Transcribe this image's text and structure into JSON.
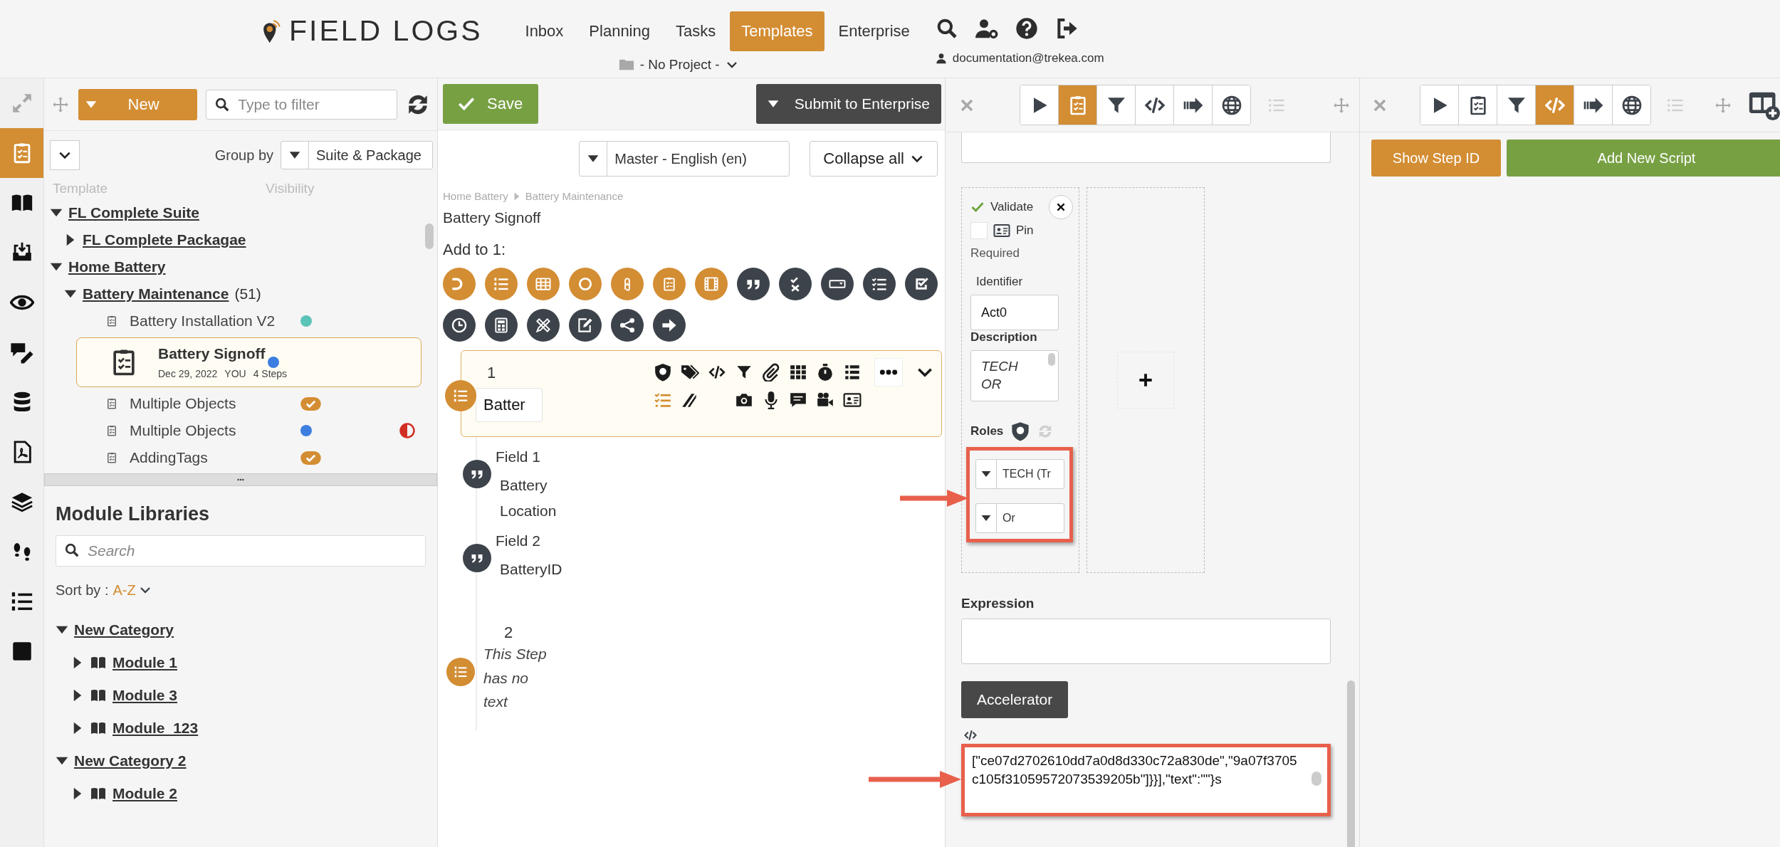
{
  "header": {
    "logo": "FIELD LOGS",
    "nav": [
      {
        "label": "Inbox",
        "selected": false
      },
      {
        "label": "Planning",
        "selected": false
      },
      {
        "label": "Tasks",
        "selected": false
      },
      {
        "label": "Templates",
        "selected": true
      },
      {
        "label": "Enterprise",
        "selected": false
      }
    ],
    "project": "- No Project -",
    "user_email": "documentation@trekea.com"
  },
  "rail": [
    {
      "kind": "expand",
      "selected": false
    },
    {
      "kind": "clipboard",
      "selected": true
    },
    {
      "kind": "book",
      "selected": false
    },
    {
      "kind": "inbox",
      "selected": false
    },
    {
      "kind": "eye",
      "selected": false
    },
    {
      "kind": "chat-pencil",
      "selected": false
    },
    {
      "kind": "database",
      "selected": false
    },
    {
      "kind": "pdf",
      "selected": false
    },
    {
      "kind": "layers",
      "selected": false
    },
    {
      "kind": "footprints",
      "selected": false
    },
    {
      "kind": "numbered-list",
      "selected": false
    },
    {
      "kind": "square",
      "selected": false
    }
  ],
  "templates": {
    "new_button": "New",
    "filter_placeholder": "Type to filter",
    "group_by_label": "Group by",
    "group_by_value": "Suite & Package",
    "columns": [
      "Template",
      "Visibility"
    ],
    "tree": [
      {
        "name": "FL Complete Suite",
        "expanded": true,
        "children": [
          {
            "name": "FL Complete Packagae",
            "expanded": false
          }
        ]
      },
      {
        "name": "Home Battery",
        "expanded": true,
        "children": [
          {
            "name": "Battery Maintenance",
            "count": "(51)",
            "expanded": true,
            "children": [
              {
                "name": "Battery Installation V2",
                "selected": false,
                "visibility": {
                  "kind": "dot",
                  "color": "#5bc4b8"
                },
                "partial": false
              },
              {
                "name": "Battery Signoff",
                "selected": true,
                "meta": [
                  "Dec 29, 2022",
                  "YOU",
                  "4 Steps"
                ],
                "visibility": {
                  "kind": "dot",
                  "color": "#3d7fe0"
                },
                "partial": false
              },
              {
                "name": "Multiple Objects",
                "selected": false,
                "visibility": {
                  "kind": "check",
                  "color": "#d38d33"
                },
                "partial": false
              },
              {
                "name": "Multiple Objects",
                "selected": false,
                "visibility": {
                  "kind": "dot",
                  "color": "#3d7fe0"
                },
                "partial": true
              },
              {
                "name": "AddingTags",
                "selected": false,
                "visibility": {
                  "kind": "check",
                  "color": "#d38d33"
                },
                "partial": false
              }
            ]
          }
        ]
      }
    ]
  },
  "modules": {
    "title": "Module Libraries",
    "search_placeholder": "Search",
    "sort_label": "Sort by :",
    "sort_value": "A-Z",
    "categories": [
      {
        "name": "New Category",
        "expanded": true,
        "children": [
          {
            "name": "Module 1",
            "expanded": false
          },
          {
            "name": "Module 3",
            "expanded": false
          },
          {
            "name": "Module_123",
            "expanded": false
          }
        ]
      },
      {
        "name": "New Category 2",
        "expanded": true,
        "children": [
          {
            "name": "Module 2",
            "expanded": false
          }
        ]
      }
    ]
  },
  "editor": {
    "save": "Save",
    "submit": "Submit to Enterprise",
    "language": "Master - English (en)",
    "collapse": "Collapse all",
    "breadcrumb": [
      "Home Battery",
      "Battery Maintenance"
    ],
    "title": "Battery Signoff",
    "add_to": "Add to 1:",
    "palette": [
      {
        "kind": "arc",
        "color": "#d38d33"
      },
      {
        "kind": "numbered-list",
        "color": "#d38d33"
      },
      {
        "kind": "table",
        "color": "#d38d33"
      },
      {
        "kind": "ring",
        "color": "#d38d33"
      },
      {
        "kind": "attachment",
        "color": "#d38d33"
      },
      {
        "kind": "clipboard",
        "color": "#d38d33"
      },
      {
        "kind": "film",
        "color": "#d38d33"
      },
      {
        "kind": "quote",
        "color": "#3d434a"
      },
      {
        "kind": "check-x",
        "color": "#3d434a"
      },
      {
        "kind": "dropdown",
        "color": "#3d434a"
      },
      {
        "kind": "checklist",
        "color": "#3d434a"
      },
      {
        "kind": "checkbox",
        "color": "#3d434a"
      },
      {
        "kind": "clock",
        "color": "#3d434a"
      },
      {
        "kind": "calculator",
        "color": "#3d434a"
      },
      {
        "kind": "pencil-ruler",
        "color": "#3d434a"
      },
      {
        "kind": "edit",
        "color": "#3d434a"
      },
      {
        "kind": "share",
        "color": "#3d434a"
      },
      {
        "kind": "arrow-right",
        "color": "#3d434a"
      }
    ],
    "steps": [
      {
        "number": "1",
        "name": "Batter",
        "selected": true,
        "fields": [
          {
            "label": "Field 1",
            "text": "Battery Location"
          },
          {
            "label": "Field 2",
            "text": "BatteryID"
          }
        ]
      },
      {
        "number": "2",
        "note": "This Step has no text",
        "selected": false
      }
    ]
  },
  "inspector": {
    "tabs": [
      {
        "kind": "play",
        "selected": false
      },
      {
        "kind": "clipboard",
        "selected": true
      },
      {
        "kind": "filter",
        "selected": false
      },
      {
        "kind": "code",
        "selected": false
      },
      {
        "kind": "steps",
        "selected": false
      },
      {
        "kind": "globe",
        "selected": false
      }
    ],
    "condition": {
      "validate": "Validate",
      "validated": true,
      "pin_checked": false,
      "pin_label": "Pin",
      "required": "Required",
      "identifier_label": "Identifier",
      "identifier": "Act0",
      "description_label": "Description",
      "description": "TECH OR",
      "roles_label": "Roles",
      "role": "TECH (Tr",
      "operator": "Or"
    },
    "expression_label": "Expression",
    "accelerator": "Accelerator",
    "code": "[\"ce07d2702610dd7a0d8d330c72a830de\",\"9a07f3705c105f31059572073539205b\"]}}],\"text\":\"\"}s"
  },
  "scripts": {
    "tabs": [
      {
        "kind": "play",
        "selected": false
      },
      {
        "kind": "clipboard",
        "selected": false
      },
      {
        "kind": "filter",
        "selected": false
      },
      {
        "kind": "code",
        "selected": true
      },
      {
        "kind": "steps",
        "selected": false
      },
      {
        "kind": "globe",
        "selected": false
      }
    ],
    "show_step_id": "Show Step ID",
    "add_script": "Add New Script"
  }
}
